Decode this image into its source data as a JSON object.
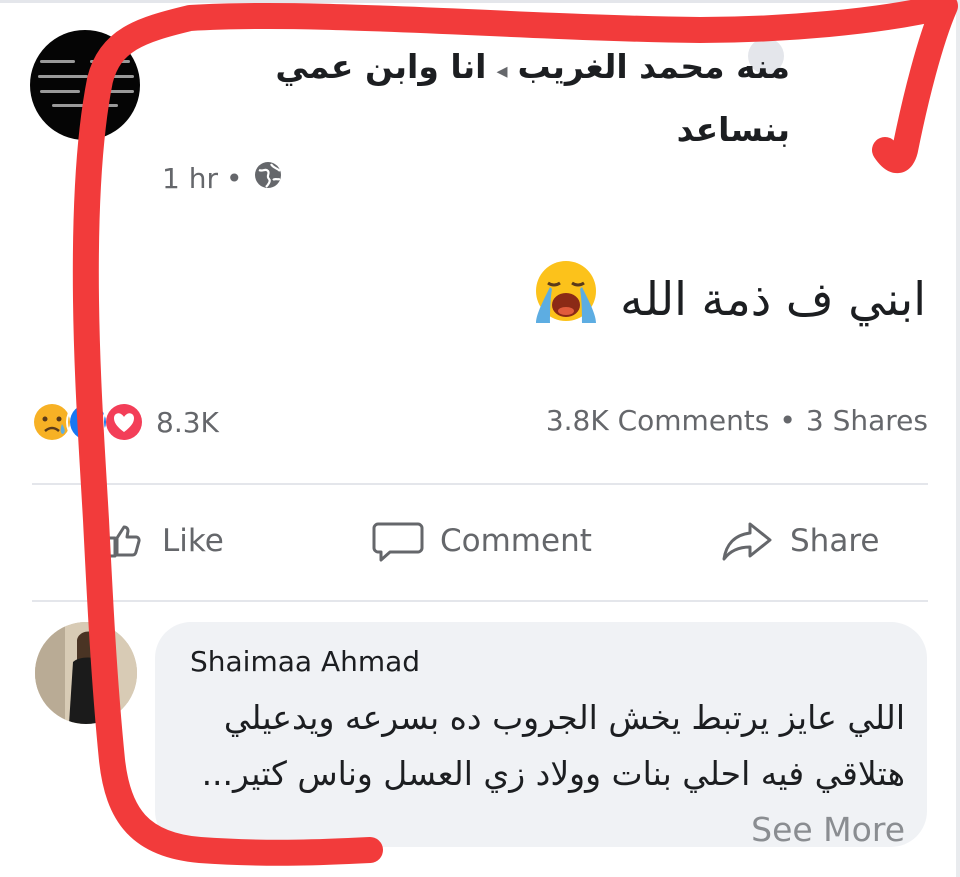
{
  "post": {
    "title": "منه محمد الغريب ▸ انا وابن عمي بنساعد",
    "author": "منه محمد الغريب",
    "group": "انا وابن عمي بنساعد",
    "timestamp": "1 hr",
    "privacy_icon": "globe-icon",
    "text": "ابني ف ذمة الله",
    "emoji": "loudly-crying-face"
  },
  "stats": {
    "reaction_icons": [
      "sad-reaction-icon",
      "like-reaction-icon",
      "love-reaction-icon"
    ],
    "reaction_count": "8.3K",
    "comments": "3.8K Comments",
    "separator": "•",
    "shares": "3 Shares"
  },
  "actions": {
    "like": "Like",
    "comment": "Comment",
    "share": "Share"
  },
  "comment": {
    "author": "Shaimaa Ahmad",
    "text": "اللي عايز يرتبط يخش الجروب ده بسرعه ويدعيلي هتلاقي فيه احلي بنات وولاد زي العسل وناس كتير...",
    "see_more": "See More"
  },
  "colors": {
    "secondary_text": "#65676b",
    "annotation_red": "#f23b3b",
    "bubble_bg": "#f0f2f5"
  }
}
